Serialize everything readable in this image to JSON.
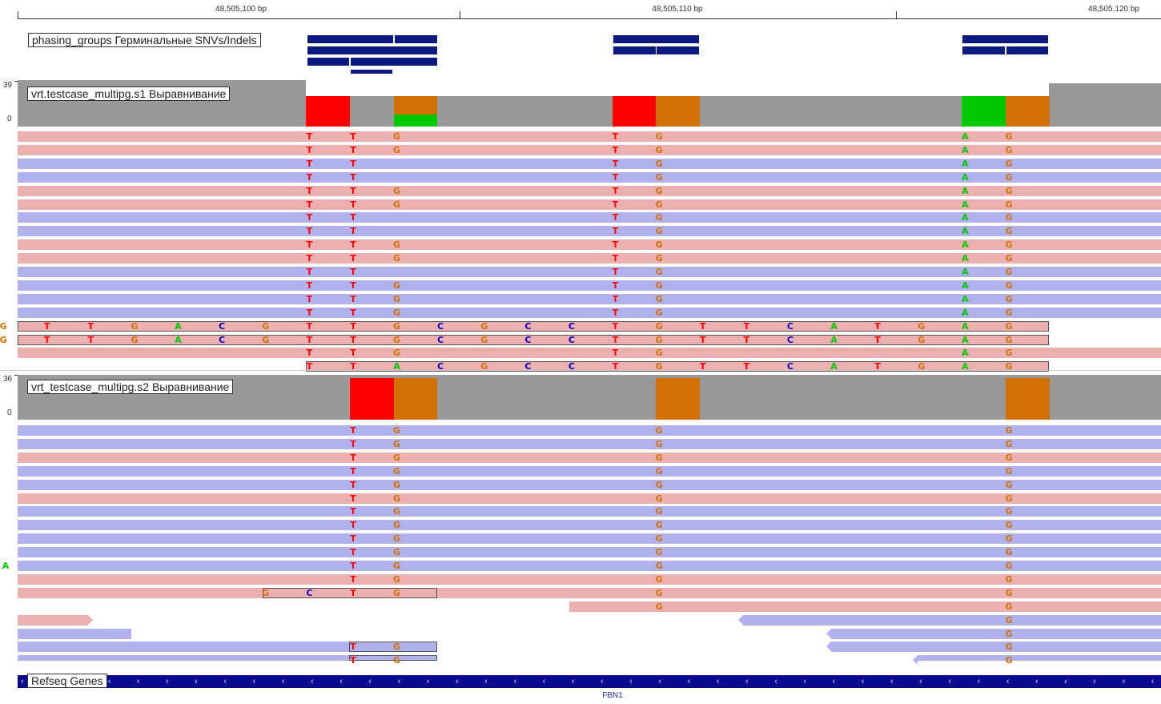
{
  "ruler": {
    "ticks": [
      "48,505,100 bp",
      "48,505,110 bp",
      "48,505,120 bp"
    ]
  },
  "tracks": {
    "phasing": {
      "label": "phasing_groups Герминальные SNVs/Indels"
    },
    "s1": {
      "label": "vrt.testcase_multipg.s1 Выравнивание",
      "scale_max": "39",
      "scale_min": "0"
    },
    "s2": {
      "label": "vrt_testcase_multipg.s2 Выравнивание",
      "scale_max": "36",
      "scale_min": "0"
    },
    "refseq": {
      "label": "Refseq Genes",
      "gene_name": "FBN1"
    }
  },
  "colors": {
    "A": "#00c800",
    "C": "#0000c8",
    "G": "#d17105",
    "T": "#ff0000",
    "read_pos": "#edb0b0",
    "read_neg": "#b1b1ee",
    "coverage": "#999999",
    "feature": "#0a1a80"
  }
}
